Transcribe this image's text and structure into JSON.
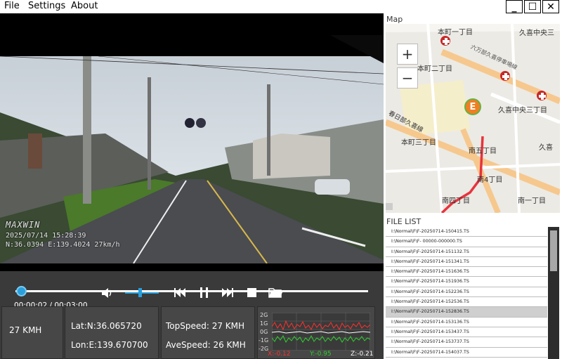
{
  "menu": {
    "file": "File",
    "settings": "Settings",
    "about": "About"
  },
  "window": {
    "minimize": "_",
    "maximize": "☐",
    "close": "✕"
  },
  "video": {
    "brand": "MAXWIN",
    "datetime": "2025/07/14   15:28:39",
    "coords": "N:36.0394   E:139.4024   27km/h"
  },
  "player": {
    "time": "00:00:02 / 00:03:00",
    "progress_fraction": 0.01,
    "volume_fraction": 0.45
  },
  "info": {
    "speed": "27 KMH",
    "lat": "Lat:N:36.065720",
    "lon": "Lon:E:139.670700",
    "top_speed": "TopSpeed: 27 KMH",
    "ave_speed": "AveSpeed: 26 KMH",
    "gsensor": {
      "y_ticks": [
        "2G",
        "1G",
        "0G",
        "-1G",
        "-2G"
      ],
      "x_value": "X:-0.12",
      "y_value": "Y:-0.95",
      "z_value": "Z:-0.21"
    }
  },
  "map": {
    "title": "Map",
    "zoom_in": "+",
    "zoom_out": "−",
    "marker": "E",
    "labels": [
      "本町一丁目",
      "六万部久喜停車場線",
      "久喜中央三",
      "本町二丁目",
      "久喜中央三丁目",
      "春日部久喜線",
      "本町三丁目",
      "南五丁目",
      "久喜",
      "南4丁目",
      "南四丁目",
      "南一丁目"
    ]
  },
  "file_list": {
    "title": "FILE LIST",
    "selected_index": 8,
    "items": [
      "I:\\Normal\\F\\F-20250714-150415.TS",
      "I:\\Normal\\F\\F-    00000-000000.TS",
      "I:\\Normal\\F\\F-20250714-151132.TS",
      "I:\\Normal\\F\\F-20250714-151341.TS",
      "I:\\Normal\\F\\F-20250714-151636.TS",
      "I:\\Normal\\F\\F-20250714-151936.TS",
      "I:\\Normal\\F\\F-20250714-152236.TS",
      "I:\\Normal\\F\\F-20250714-152536.TS",
      "I:\\Normal\\F\\F-20250714-152836.TS",
      "I:\\Normal\\F\\F-20250714-153136.TS",
      "I:\\Normal\\F\\F-20250714-153437.TS",
      "I:\\Normal\\F\\F-20250714-153737.TS",
      "I:\\Normal\\F\\F-20250714-154037.TS",
      "I:\\Normal\\F\\F-20250714-154337.TS"
    ]
  }
}
